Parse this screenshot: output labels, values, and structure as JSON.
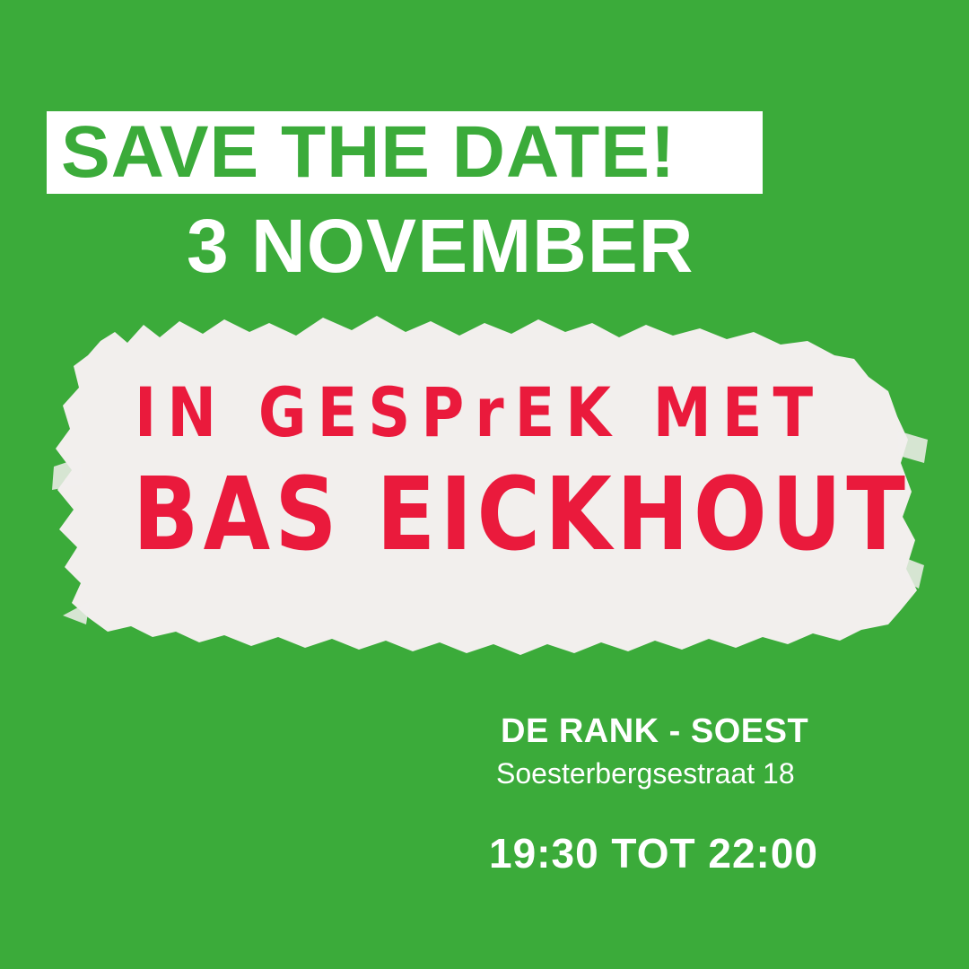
{
  "header": {
    "save_the_date": "SAVE THE DATE!",
    "date": "3 NOVEMBER"
  },
  "headline": {
    "line1": "IN GESPrEK MET",
    "line2": "BAS EICKHOUT"
  },
  "location": {
    "venue": "DE RANK - SOEST",
    "address": "Soesterbergsestraat 18"
  },
  "time": "19:30 TOT 22:00",
  "colors": {
    "background": "#3bab3a",
    "brush": "#f2efed",
    "headline": "#ea1a3c",
    "text": "#ffffff"
  }
}
